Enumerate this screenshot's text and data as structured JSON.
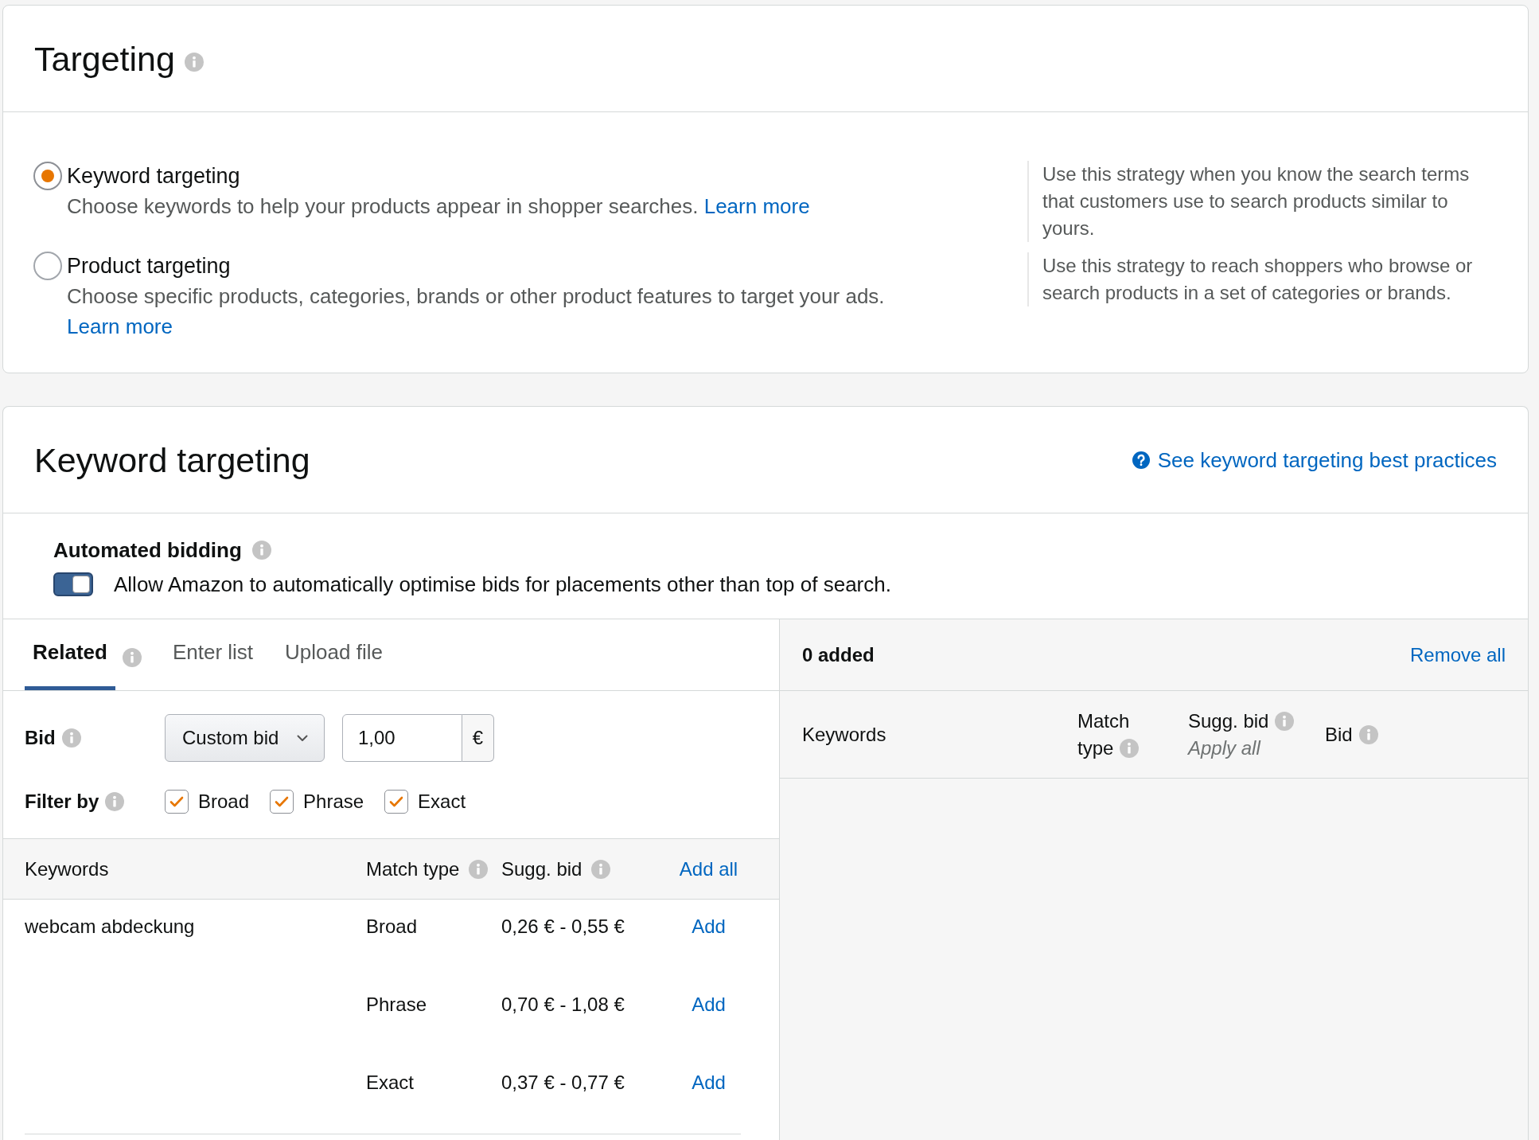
{
  "targeting_card": {
    "title": "Targeting",
    "options": [
      {
        "label": "Keyword targeting",
        "description": "Choose keywords to help your products appear in shopper searches.",
        "link": "Learn more",
        "note": "Use this strategy when you know the search terms that customers use to search products similar to yours.",
        "selected": true
      },
      {
        "label": "Product targeting",
        "description": "Choose specific products, categories, brands or other product features to target your ads.",
        "link": "Learn more",
        "note": "Use this strategy to reach shoppers who browse or search products in a set of categories or brands.",
        "selected": false
      }
    ]
  },
  "keyword_card": {
    "title": "Keyword targeting",
    "help_link": "See keyword targeting best practices",
    "automated_bidding": {
      "label": "Automated bidding",
      "description": "Allow Amazon to automatically optimise bids for placements other than top of search.",
      "on": true
    },
    "tabs": [
      {
        "label": "Related",
        "info": true,
        "selected": true
      },
      {
        "label": "Enter list",
        "info": false,
        "selected": false
      },
      {
        "label": "Upload file",
        "info": false,
        "selected": false
      }
    ],
    "bid": {
      "label": "Bid",
      "strategy": "Custom bid",
      "value": "1,00",
      "currency": "€"
    },
    "filter": {
      "label": "Filter by",
      "options": [
        {
          "label": "Broad",
          "checked": true
        },
        {
          "label": "Phrase",
          "checked": true
        },
        {
          "label": "Exact",
          "checked": true
        }
      ]
    },
    "suggestions": {
      "columns": [
        {
          "label": "Keywords",
          "info": false
        },
        {
          "label": "Match type",
          "info": true
        },
        {
          "label": "Sugg. bid",
          "info": true
        }
      ],
      "add_all": "Add all",
      "groups": [
        {
          "keyword": "webcam abdeckung",
          "rows": [
            {
              "match_type": "Broad",
              "suggested_bid": "0,26 € - 0,55 €",
              "action": "Add"
            },
            {
              "match_type": "Phrase",
              "suggested_bid": "0,70 € - 1,08 €",
              "action": "Add"
            },
            {
              "match_type": "Exact",
              "suggested_bid": "0,37 € - 0,77 €",
              "action": "Add"
            }
          ]
        }
      ]
    },
    "added": {
      "count": "0 added",
      "remove_all": "Remove all",
      "columns": [
        {
          "label": "Keywords",
          "info": false
        },
        {
          "label": "Match type",
          "info": true
        },
        {
          "label": "Sugg. bid",
          "info": true,
          "sublabel": "Apply all"
        },
        {
          "label": "Bid",
          "info": true
        }
      ]
    }
  }
}
